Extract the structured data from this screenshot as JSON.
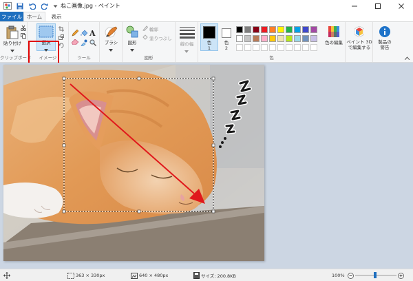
{
  "window": {
    "title": "ねこ画像.jpg - ペイント",
    "minimize_icon": "minimize-icon",
    "maximize_icon": "maximize-icon",
    "close_icon": "close-icon"
  },
  "tabs": [
    {
      "label": "ファイル"
    },
    {
      "label": "ホーム"
    },
    {
      "label": "表示"
    }
  ],
  "ribbon": {
    "clipboard": {
      "paste_label": "貼り付け",
      "group_label": "クリップボード"
    },
    "image": {
      "select_label": "選択",
      "group_label": "イメージ"
    },
    "tools": {
      "group_label": "ツール"
    },
    "brushes": {
      "label": "ブラシ"
    },
    "shapes": {
      "shapes_label": "図形",
      "outline_label": "輪郭",
      "fill_label": "塗りつぶし",
      "group_label": "図形"
    },
    "size": {
      "label": "線の幅"
    },
    "colors": {
      "color1_label": "色",
      "color1_num": "1",
      "color2_label": "色",
      "color2_num": "2",
      "edit_colors_label": "色の編集",
      "group_label": "色",
      "color1": "#000000",
      "color2": "#ffffff",
      "palette_row1": [
        "#000000",
        "#7f7f7f",
        "#880015",
        "#ed1c24",
        "#ff7f27",
        "#fff200",
        "#22b14c",
        "#00a2e8",
        "#3f48cc",
        "#a349a4"
      ],
      "palette_row2": [
        "#ffffff",
        "#c3c3c3",
        "#b97a57",
        "#ffaec9",
        "#ffc90e",
        "#efe4b0",
        "#b5e61d",
        "#99d9ea",
        "#7092be",
        "#c8bfe7"
      ]
    },
    "paint3d": {
      "label_line1": "ペイント 3D",
      "label_line2": "で編集する"
    },
    "product_alert": {
      "label_line1": "製品の",
      "label_line2": "警告"
    }
  },
  "status": {
    "selection_size": "363 × 330px",
    "image_size": "640 × 480px",
    "file_size": "サイズ: 200.8KB",
    "zoom": "100%"
  }
}
